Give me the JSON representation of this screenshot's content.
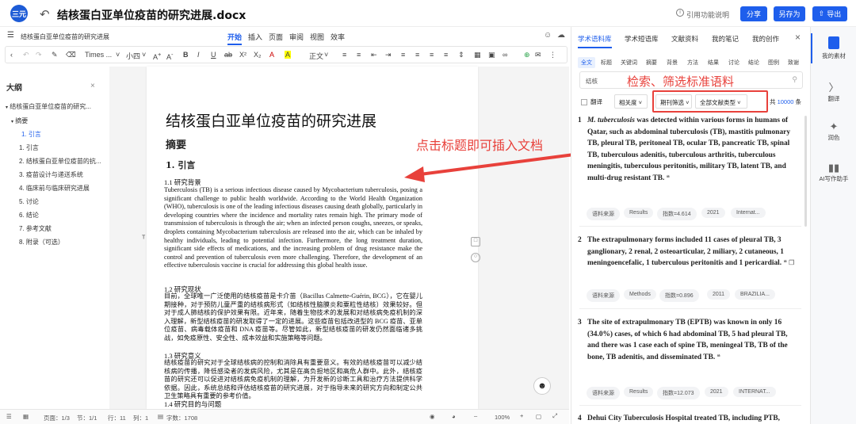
{
  "app": {
    "logo_text": "三元"
  },
  "header": {
    "title": "结核蛋白亚单位疫苗的研究进展.docx",
    "cite_label": "引用功能说明",
    "share_label": "分享",
    "save_as_label": "另存为",
    "export_label": "导出"
  },
  "menu": {
    "doc_name": "结核蛋白亚单位疫苗的研究进展",
    "tabs": [
      "开始",
      "插入",
      "页面",
      "审阅",
      "视图",
      "效率"
    ]
  },
  "format": {
    "font": "Times ...",
    "size": "小四",
    "style": "正文"
  },
  "outline": {
    "title": "大纲",
    "items": [
      "结核蛋白亚单位疫苗的研究...",
      "摘要",
      "1. 引言",
      "1. 引言",
      "2. 结核蛋白亚单位疫苗的抗...",
      "3. 疫苗设计与递送系统",
      "4. 临床前与临床研究进展",
      "5. 讨论",
      "6. 结论",
      "7. 参考文献",
      "8. 附录（可选）"
    ]
  },
  "doc": {
    "title": "结核蛋白亚单位疫苗的研究进展",
    "abstract": "摘要",
    "section1": "1.  引言",
    "s11": "1.1 研究背景",
    "p11": "Tuberculosis (TB) is a serious infectious disease caused by Mycobacterium tuberculosis, posing a significant challenge to public health worldwide. According to the World Health Organization (WHO), tuberculosis is one of the leading infectious diseases causing death globally, particularly in developing countries where the incidence and mortality rates remain high. The primary mode of transmission of tuberculosis is through the air; when an infected person coughs, sneezes, or speaks, droplets containing Mycobacterium tuberculosis are released into the air, which can be inhaled by healthy individuals, leading to potential infection. Furthermore, the long treatment duration, significant side effects of medications, and the increasing problem of drug resistance make the control and prevention of tuberculosis even more challenging. Therefore, the development of an effective tuberculosis vaccine is crucial for addressing this global health issue.",
    "s12": "1.2 研究现状",
    "p12": "目前，全球唯一广泛使用的结核疫苗是卡介苗（Bacillus Calmette-Guérin, BCG），它在婴儿期接种，对于预防儿童严重的结核病形式（如结核性脑膜炎和粟粒性结核）效果较好。但对于成人肺结核的保护效果有限。近年来，随着生物技术的发展和对结核病免疫机制的深入理解，新型结核疫苗的研发取得了一定的进展。这些疫苗包括改进型的 BCG 疫苗、亚单位疫苗、病毒载体疫苗和 DNA 疫苗等。尽管如此，新型结核疫苗的研发仍然面临诸多挑战，如免疫原性、安全性、成本效益和实施策略等问题。",
    "s13": "1.3 研究意义",
    "p13": "结核疫苗的研究对于全球结核病的控制和消除具有重要意义。有效的结核疫苗可以减少结核病的传播，降低感染者的发病风险，尤其是在高负担地区和高危人群中。此外，结核疫苗的研究还可以促进对结核病免疫机制的理解，为开发新的诊断工具和治疗方法提供科学依据。因此，系统总结和评估结核疫苗的研究进展，对于指导未来的研究方向和制定公共卫生策略具有重要的参考价值。",
    "s14": "1.4 研究目的与问题"
  },
  "status": {
    "page": "页面：1/3",
    "section": "节：1/1",
    "line": "行：11",
    "col": "列：1",
    "words": "字数：1708",
    "zoom": "100%"
  },
  "annotations": {
    "insert": "点击标题即可插入文档",
    "search": "检索、筛选标准语料"
  },
  "right_panel": {
    "tabs": [
      "学术语料库",
      "学术短语库",
      "文献资料",
      "我的笔记",
      "我的创作"
    ],
    "chips": [
      "全文",
      "标题",
      "关键词",
      "摘要",
      "背景",
      "方法",
      "结果",
      "讨论",
      "结论",
      "图例",
      "致谢"
    ],
    "search_value": "结核",
    "translate": "翻译",
    "relevance": "相关度",
    "journal_filter": "期刊筛选",
    "doc_type": "全部文献类型",
    "total_prefix": "共",
    "total": "10000",
    "total_suffix": "条",
    "results": [
      {
        "num": "1",
        "italic": "M. tuberculosis",
        "text": " was detected within various forms in humans of Qatar, such as abdominal tuberculosis (TB), mastitis pulmonary TB, pleural TB, peritoneal TB, ocular TB, pancreatic TB, spinal TB, tuberculous adenitis, tuberculous arthritis, tuberculous meningitis, tuberculous peritonitis, military TB, latent TB, and multi-drug resistant TB.",
        "tags": [
          "语料来源",
          "Results",
          "指数=4.614",
          "2021",
          "Internat..."
        ]
      },
      {
        "num": "2",
        "italic": "",
        "text": "The extrapulmonary forms included 11 cases of pleural TB, 3 ganglionary, 2 renal, 2 osteoarticular, 2 miliary, 2 cutaneous, 1 meningoencefalic, 1 tuberculous peritonitis and 1 pericardial.",
        "tags": [
          "语料来源",
          "Methods",
          "指数=0.896",
          "2011",
          "BRAZILIA..."
        ]
      },
      {
        "num": "3",
        "italic": "",
        "text": "The site of extrapulmonary TB (EPTB) was known in only 16 (34.0%) cases, of which 6 had abdominal TB, 5 had pleural TB, and there was 1 case each of spine TB, meningeal TB, TB of the bone, TB adenitis, and disseminated TB.",
        "tags": [
          "语料来源",
          "Results",
          "指数=12.073",
          "2021",
          "INTERNAT..."
        ]
      },
      {
        "num": "4",
        "italic": "",
        "text": "Dehui City Tuberculosis Hospital treated TB, including PTB,",
        "tags": []
      }
    ]
  },
  "sidebar": {
    "items": [
      "我的素材",
      "翻译",
      "润色",
      "AI写作助手"
    ]
  },
  "colors": {
    "accent": "#1e5eec",
    "annotation": "#e8413b"
  }
}
